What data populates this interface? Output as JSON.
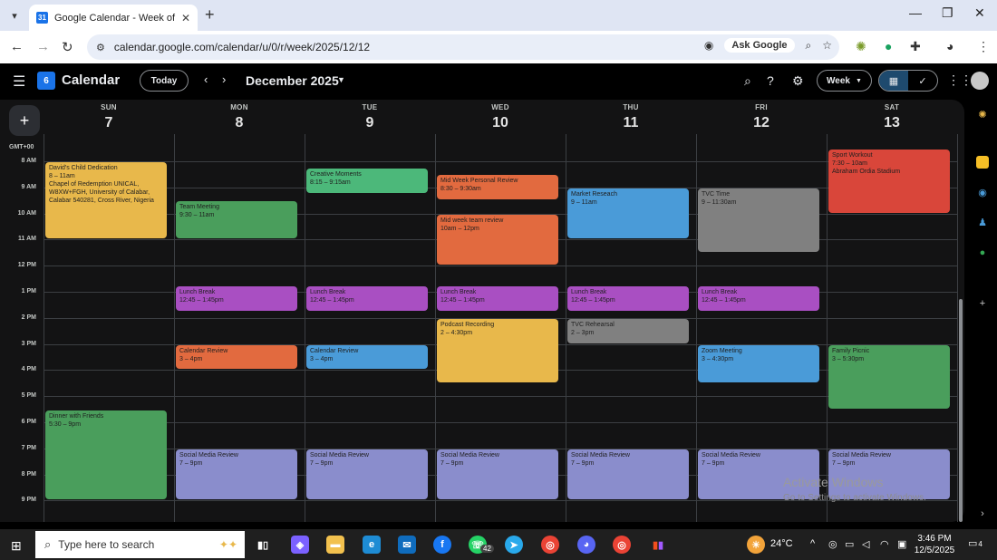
{
  "browser": {
    "tab_title": "Google Calendar - Week of Dec",
    "url": "calendar.google.com/calendar/u/0/r/week/2025/12/12",
    "ask_google": "Ask Google"
  },
  "header": {
    "app_name": "Calendar",
    "today_label": "Today",
    "month_label": "December 2025",
    "view_label": "Week"
  },
  "grid": {
    "timezone": "GMT+00",
    "hours": [
      "8 AM",
      "9 AM",
      "10 AM",
      "11 AM",
      "12 PM",
      "1 PM",
      "2 PM",
      "3 PM",
      "4 PM",
      "5 PM",
      "6 PM",
      "7 PM",
      "8 PM",
      "9 PM"
    ],
    "days": [
      {
        "name": "SUN",
        "date": "7"
      },
      {
        "name": "MON",
        "date": "8"
      },
      {
        "name": "TUE",
        "date": "9"
      },
      {
        "name": "WED",
        "date": "10"
      },
      {
        "name": "THU",
        "date": "11"
      },
      {
        "name": "FRI",
        "date": "12"
      },
      {
        "name": "SAT",
        "date": "13"
      }
    ]
  },
  "events": [
    {
      "title": "David's Child Dedication",
      "time": "8 – 11am",
      "location": "Chapel of Redemption UNICAL, W8XW+FGH, University of Calabar, Calabar 540281, Cross River, Nigeria",
      "day": 0,
      "start": 8,
      "end": 11,
      "color": "#e8b84b"
    },
    {
      "title": "Dinner with Friends",
      "time": "5:30 – 9pm",
      "day": 0,
      "start": 17.5,
      "end": 21,
      "color": "#4a9e5c"
    },
    {
      "title": "Team Meeting",
      "time": "9:30 – 11am",
      "day": 1,
      "start": 9.5,
      "end": 11,
      "color": "#4a9e5c"
    },
    {
      "title": "Lunch Break",
      "time": "12:45 – 1:45pm",
      "day": 1,
      "start": 12.75,
      "end": 13.75,
      "color": "#a94fc2"
    },
    {
      "title": "Calendar Review",
      "time": "3 – 4pm",
      "day": 1,
      "start": 15,
      "end": 16,
      "color": "#e26a3f"
    },
    {
      "title": "Social Media Review",
      "time": "7 – 9pm",
      "day": 1,
      "start": 19,
      "end": 21,
      "color": "#8a8dcc"
    },
    {
      "title": "Creative Moments",
      "time": "8:15 – 9:15am",
      "day": 2,
      "start": 8.25,
      "end": 9.25,
      "color": "#4cb87a"
    },
    {
      "title": "Lunch Break",
      "time": "12:45 – 1:45pm",
      "day": 2,
      "start": 12.75,
      "end": 13.75,
      "color": "#a94fc2"
    },
    {
      "title": "Calendar Review",
      "time": "3 – 4pm",
      "day": 2,
      "start": 15,
      "end": 16,
      "color": "#4a9bd8"
    },
    {
      "title": "Social Media Review",
      "time": "7 – 9pm",
      "day": 2,
      "start": 19,
      "end": 21,
      "color": "#8a8dcc"
    },
    {
      "title": "Mid Week Personal Review",
      "time": "8:30 – 9:30am",
      "day": 3,
      "start": 8.5,
      "end": 9.5,
      "color": "#e26a3f"
    },
    {
      "title": "Mid week team review",
      "time": "10am – 12pm",
      "day": 3,
      "start": 10,
      "end": 12,
      "color": "#e26a3f"
    },
    {
      "title": "Lunch Break",
      "time": "12:45 – 1:45pm",
      "day": 3,
      "start": 12.75,
      "end": 13.75,
      "color": "#a94fc2"
    },
    {
      "title": "Podcast Recording",
      "time": "2 – 4:30pm",
      "day": 3,
      "start": 14,
      "end": 16.5,
      "color": "#e8b84b"
    },
    {
      "title": "Social Media Review",
      "time": "7 – 9pm",
      "day": 3,
      "start": 19,
      "end": 21,
      "color": "#8a8dcc"
    },
    {
      "title": "Market Reseach",
      "time": "9 – 11am",
      "day": 4,
      "start": 9,
      "end": 11,
      "color": "#4a9bd8"
    },
    {
      "title": "Lunch Break",
      "time": "12:45 – 1:45pm",
      "day": 4,
      "start": 12.75,
      "end": 13.75,
      "color": "#a94fc2"
    },
    {
      "title": "TVC Rehearsal",
      "time": "2 – 3pm",
      "day": 4,
      "start": 14,
      "end": 15,
      "color": "#808080"
    },
    {
      "title": "Social Media Review",
      "time": "7 – 9pm",
      "day": 4,
      "start": 19,
      "end": 21,
      "color": "#8a8dcc"
    },
    {
      "title": "TVC Time",
      "time": "9 – 11:30am",
      "day": 5,
      "start": 9,
      "end": 11.5,
      "color": "#808080"
    },
    {
      "title": "Lunch Break",
      "time": "12:45 – 1:45pm",
      "day": 5,
      "start": 12.75,
      "end": 13.75,
      "color": "#a94fc2"
    },
    {
      "title": "Zoom Meeting",
      "time": "3 – 4:30pm",
      "day": 5,
      "start": 15,
      "end": 16.5,
      "color": "#4a9bd8"
    },
    {
      "title": "Social Media Review",
      "time": "7 – 9pm",
      "day": 5,
      "start": 19,
      "end": 21,
      "color": "#8a8dcc"
    },
    {
      "title": "Sport Workout",
      "time": "7:30 – 10am",
      "location": "Abraham Ordia Stadium",
      "day": 6,
      "start": 7.5,
      "end": 10,
      "color": "#d9463a"
    },
    {
      "title": "Family Picnic",
      "time": "3 – 5:30pm",
      "day": 6,
      "start": 15,
      "end": 17.5,
      "color": "#4a9e5c"
    },
    {
      "title": "Social Media Review",
      "time": "7 – 9pm",
      "day": 6,
      "start": 19,
      "end": 21,
      "color": "#8a8dcc"
    }
  ],
  "watermark": {
    "line1": "Activate Windows",
    "line2": "Go to Settings to activate Windows."
  },
  "taskbar": {
    "search_placeholder": "Type here to search",
    "weather": "24°C",
    "time": "3:46 PM",
    "date": "12/5/2025",
    "whatsapp_badge": "42",
    "notifications": "4"
  }
}
